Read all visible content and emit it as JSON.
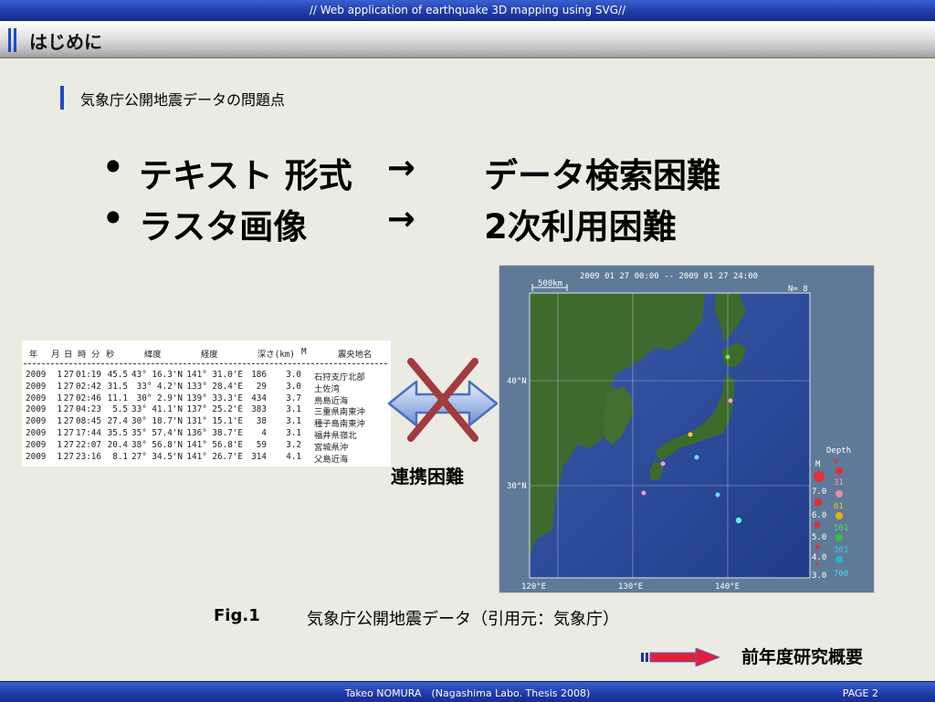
{
  "header": {
    "banner": "// Web application of earthquake 3D mapping using SVG//"
  },
  "slide": {
    "title": "はじめに",
    "subtitle": "気象庁公開地震データの問題点",
    "bullets": [
      {
        "dot": "•",
        "item": "テキスト 形式",
        "arrow": "→",
        "problem": "データ検索困難"
      },
      {
        "dot": "•",
        "item": "ラスタ画像",
        "arrow": "→",
        "problem": "2次利用困難"
      }
    ],
    "link_label": "連携困難",
    "caption": {
      "fig": "Fig.1",
      "text": "気象庁公開地震データ（引用元：気象庁）"
    },
    "overview_label": "前年度研究概要"
  },
  "eq_table": {
    "headers": [
      "年",
      "月",
      "日",
      "時",
      "分",
      "秒",
      "緯度",
      "経度",
      "深さ(km)",
      "M",
      "震央地名"
    ],
    "rows": [
      [
        "2009",
        "1",
        "27",
        "01:19",
        "45.5",
        "43° 16.3'N",
        "141° 31.0'E",
        "186",
        "3.0",
        "石狩支庁北部"
      ],
      [
        "2009",
        "1",
        "27",
        "02:42",
        "31.5",
        "33°  4.2'N",
        "133° 28.4'E",
        "29",
        "3.0",
        "土佐湾"
      ],
      [
        "2009",
        "1",
        "27",
        "02:46",
        "11.1",
        "30°  2.9'N",
        "139° 33.3'E",
        "434",
        "3.7",
        "鳥島近海"
      ],
      [
        "2009",
        "1",
        "27",
        "04:23",
        "5.5",
        "33° 41.1'N",
        "137° 25.2'E",
        "383",
        "3.1",
        "三重県南東沖"
      ],
      [
        "2009",
        "1",
        "27",
        "08:45",
        "27.4",
        "30° 18.7'N",
        "131° 15.1'E",
        "38",
        "3.1",
        "種子島南東沖"
      ],
      [
        "2009",
        "1",
        "27",
        "17:44",
        "35.5",
        "35° 57.4'N",
        "136° 38.7'E",
        "4",
        "3.1",
        "福井県嶺北"
      ],
      [
        "2009",
        "1",
        "27",
        "22:07",
        "20.4",
        "38° 56.8'N",
        "141° 56.8'E",
        "59",
        "3.2",
        "宮城県沖"
      ],
      [
        "2009",
        "1",
        "27",
        "23:16",
        "8.1",
        "27° 34.5'N",
        "141° 26.7'E",
        "314",
        "4.1",
        "父島近海"
      ]
    ]
  },
  "map": {
    "period": "2009 01 27 00:00 -- 2009 01 27 24:00",
    "scale": "500km",
    "count": "N= 8",
    "lat_labels": [
      "40°N",
      "30°N"
    ],
    "lon_labels": [
      "120°E",
      "130°E",
      "140°E"
    ],
    "legend": {
      "depth_title": "Depth",
      "mag_title": "M",
      "magnitudes": [
        "7.0",
        "6.0",
        "5.0",
        "4.0",
        "3.0"
      ],
      "depths": [
        "0",
        "31",
        "61",
        "101",
        "301",
        "700"
      ],
      "depth_colors": [
        "#e0303a",
        "#e88aa8",
        "#e8b018",
        "#30c040",
        "#30b0d0",
        "#40e0e0"
      ]
    }
  },
  "footer": {
    "credit": "Takeo NOMURA　(Nagashima Labo. Thesis 2008)",
    "page": "PAGE 2"
  }
}
